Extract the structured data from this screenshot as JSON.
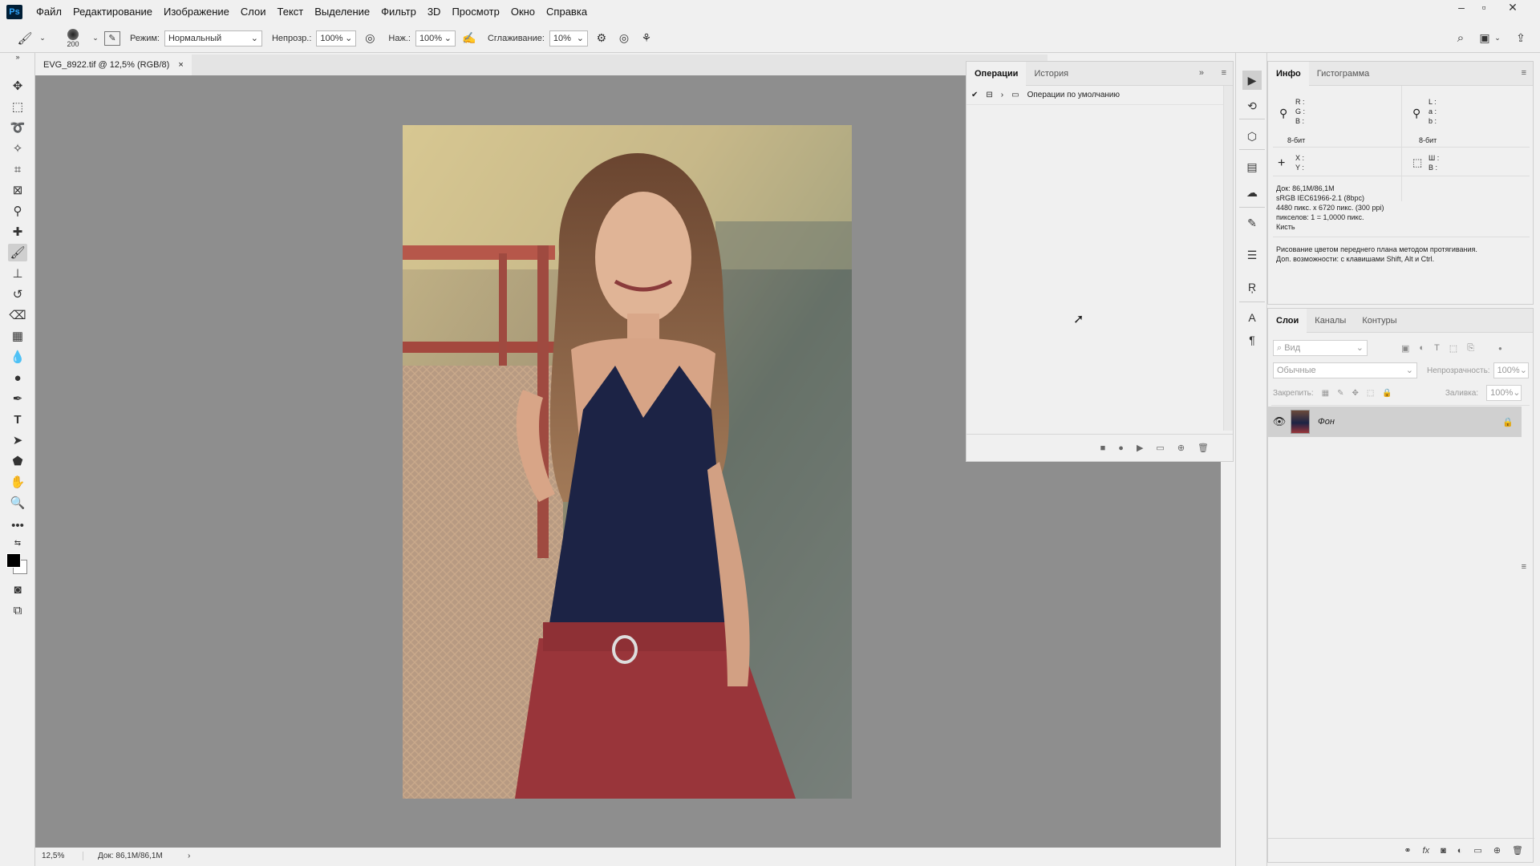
{
  "menu": {
    "logo": "Ps",
    "items": [
      "Файл",
      "Редактирование",
      "Изображение",
      "Слои",
      "Текст",
      "Выделение",
      "Фильтр",
      "3D",
      "Просмотр",
      "Окно",
      "Справка"
    ]
  },
  "options": {
    "brush_size": "200",
    "mode_label": "Режим:",
    "mode_value": "Нормальный",
    "opacity_label": "Непрозр.:",
    "opacity_value": "100%",
    "pressure_label": "Наж.:",
    "pressure_value": "100%",
    "smoothing_label": "Сглаживание:",
    "smoothing_value": "10%"
  },
  "document": {
    "tab_title": "EVG_8922.tif @ 12,5% (RGB/8)",
    "close_glyph": "×"
  },
  "status": {
    "zoom": "12,5%",
    "doc": "Док: 86,1M/86,1M",
    "arrow": "›"
  },
  "actions_panel": {
    "tabs": [
      "Операции",
      "История"
    ],
    "set_name": "Операции по умолчанию"
  },
  "info_panel": {
    "tabs": [
      "Инфо",
      "Гистограмма"
    ],
    "rgb_labels": [
      "R :",
      "G :",
      "B :"
    ],
    "lab_labels": [
      "L :",
      "a :",
      "b :"
    ],
    "bit_left": "8-бит",
    "bit_right": "8-бит",
    "xy_labels": [
      "X :",
      "Y :"
    ],
    "wh_labels": [
      "Ш :",
      "В :"
    ],
    "doc_lines": [
      "Док: 86,1M/86,1M",
      "sRGB IEC61966-2.1 (8bpc)",
      "4480 пикс. x 6720 пикс. (300 ppi)",
      "пикселов: 1 = 1,0000 пикс.",
      "Кисть"
    ],
    "hint_lines": [
      "Рисование цветом переднего плана методом протягивания.",
      "Доп. возможности: с клавишами Shift, Alt и Ctrl."
    ]
  },
  "layers_panel": {
    "tabs": [
      "Слои",
      "Каналы",
      "Контуры"
    ],
    "search_placeholder": "Вид",
    "blend_mode": "Обычные",
    "opacity_label": "Непрозрачность:",
    "opacity_value": "100%",
    "lock_label": "Закрепить:",
    "fill_label": "Заливка:",
    "fill_value": "100%",
    "layer_name": "Фон"
  }
}
